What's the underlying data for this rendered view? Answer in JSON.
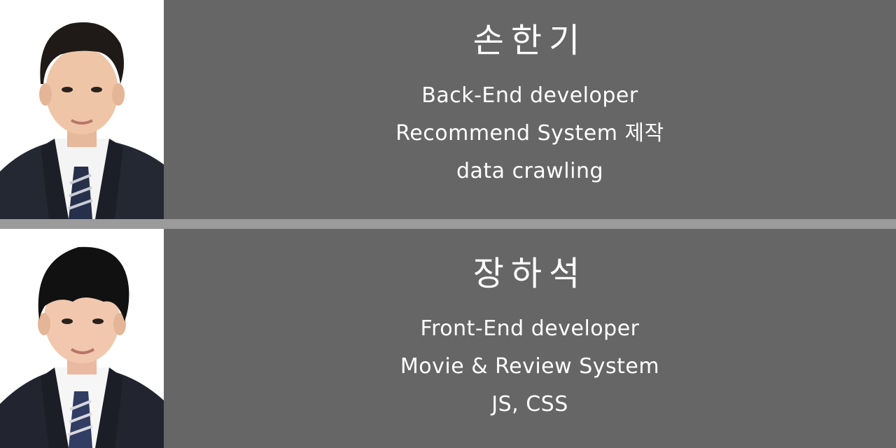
{
  "members": [
    {
      "name": "손한기",
      "lines": [
        "Back-End developer",
        "Recommend System 제작",
        "data crawling"
      ]
    },
    {
      "name": "장하석",
      "lines": [
        "Front-End developer",
        "Movie & Review System",
        "JS, CSS"
      ]
    }
  ],
  "colors": {
    "card_background": "#666666",
    "divider": "#9b9b9b",
    "text": "#ffffff"
  }
}
